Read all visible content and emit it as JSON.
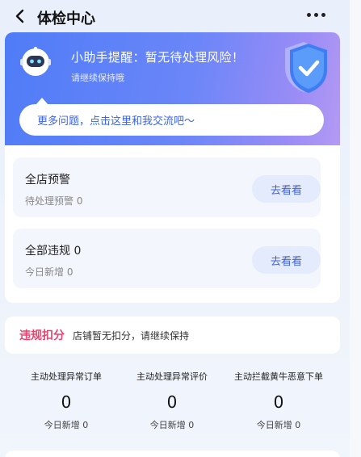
{
  "header": {
    "title": "体检中心",
    "back_icon": "chevron-left-icon",
    "more_icon": "more-horizontal-icon"
  },
  "banner": {
    "title": "小助手提醒：暂无待处理风险！",
    "subtitle": "请继续保持哦",
    "chat_prompt": "更多问题，点击这里和我交流吧～",
    "robot_icon": "robot-assistant-icon",
    "shield_icon": "shield-check-icon"
  },
  "cards": [
    {
      "title": "全店预警",
      "subtitle": "待处理预警 0",
      "button": "去看看"
    },
    {
      "title": "全部违规 0",
      "subtitle": "今日新增 0",
      "button": "去看看"
    }
  ],
  "deduction": {
    "label": "违规扣分",
    "text": "店铺暂无扣分，请继续保持"
  },
  "stats": [
    {
      "label": "主动处理异常订单",
      "value": "0",
      "sub": "今日新增 0"
    },
    {
      "label": "主动处理异常评价",
      "value": "0",
      "sub": "今日新增 0"
    },
    {
      "label": "主动拦截黄牛恶意下单",
      "value": "0",
      "sub": "今日新增 0"
    }
  ],
  "colors": {
    "accent": "#3d63e6",
    "warning": "#e9446f",
    "banner_start": "#4f7cf7",
    "banner_end": "#b49af3"
  }
}
